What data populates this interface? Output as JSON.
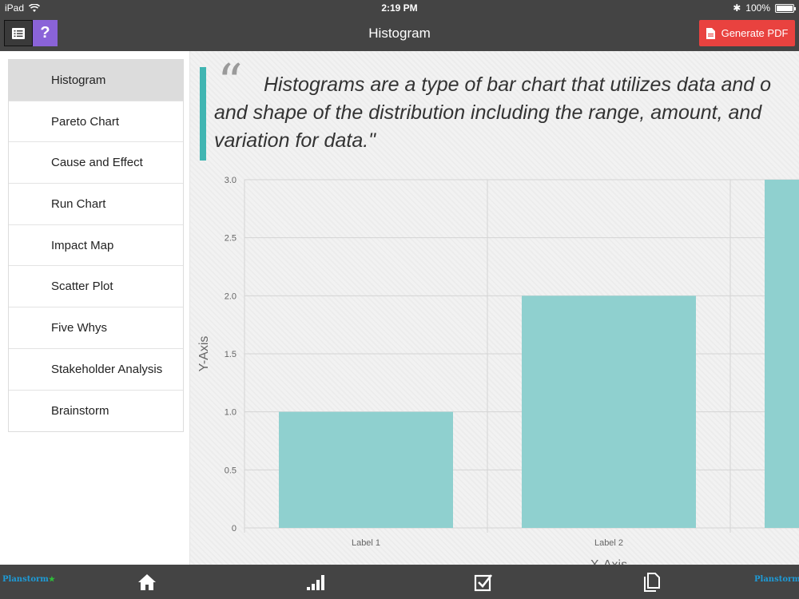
{
  "status": {
    "device": "iPad",
    "time": "2:19 PM",
    "battery": "100%"
  },
  "nav": {
    "title": "Histogram",
    "help_label": "?",
    "pdf_label": "Generate PDF"
  },
  "sidebar": {
    "items": [
      {
        "label": "Histogram",
        "active": true
      },
      {
        "label": "Pareto Chart"
      },
      {
        "label": "Cause and Effect"
      },
      {
        "label": "Run Chart"
      },
      {
        "label": "Impact Map"
      },
      {
        "label": "Scatter Plot"
      },
      {
        "label": "Five Whys"
      },
      {
        "label": "Stakeholder Analysis"
      },
      {
        "label": "Brainstorm"
      }
    ]
  },
  "quote": {
    "mark": "“",
    "line1": "Histograms are a type of bar chart that utilizes data and o",
    "line2": "and shape of the distribution including the range, amount, and",
    "line3": "variation for data.\""
  },
  "chart_data": {
    "type": "bar",
    "categories": [
      "Label 1",
      "Label 2",
      ""
    ],
    "values": [
      1.0,
      2.0,
      3.0
    ],
    "ylim": [
      0,
      3.0
    ],
    "yticks": [
      "0",
      "0.5",
      "1.0",
      "1.5",
      "2.0",
      "2.5",
      "3.0"
    ],
    "ylabel": "Y-Axis",
    "xlabel": "X-Axis",
    "grid": true,
    "bar_color": "#8fd0cf"
  },
  "footer": {
    "brand_left": "Planstorm",
    "brand_right": "Planstorm",
    "tabs": [
      "home-icon",
      "signal-bars-icon",
      "checkbox-icon",
      "documents-icon"
    ]
  },
  "colors": {
    "bar": "#444444",
    "accent": "#40b5b2",
    "help": "#8a63d8",
    "pdf": "#e9423f"
  }
}
